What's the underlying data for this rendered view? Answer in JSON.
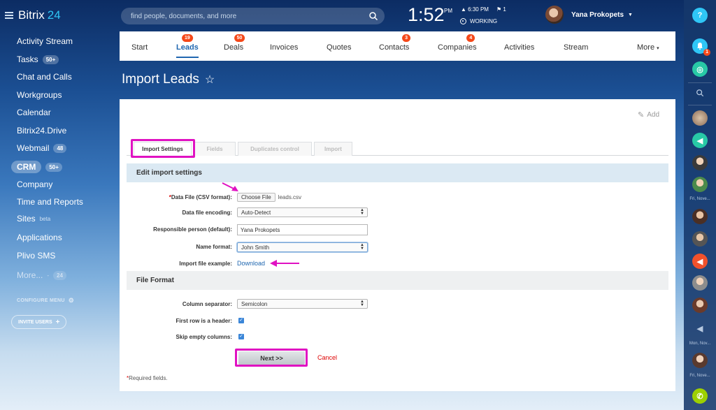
{
  "app": {
    "brand": "Bitrix",
    "brand_num": "24"
  },
  "sidebar": {
    "items": [
      {
        "label": "Activity Stream"
      },
      {
        "label": "Tasks",
        "badge": "50+"
      },
      {
        "label": "Chat and Calls"
      },
      {
        "label": "Workgroups"
      },
      {
        "label": "Calendar"
      },
      {
        "label": "Bitrix24.Drive"
      },
      {
        "label": "Webmail",
        "badge": "48"
      },
      {
        "label": "CRM",
        "badge": "50+"
      },
      {
        "label": "Company"
      },
      {
        "label": "Time and Reports"
      },
      {
        "label": "Sites",
        "sup": "beta"
      },
      {
        "label": "Applications"
      },
      {
        "label": "Plivo SMS"
      },
      {
        "label": "More...",
        "badge": "24"
      }
    ],
    "configure_menu": "CONFIGURE MENU",
    "invite_users": "INVITE USERS"
  },
  "header": {
    "search_placeholder": "find people, documents, and more",
    "clock": "1:52",
    "clock_ampm": "PM",
    "alarm": "6:30 PM",
    "flags": "1",
    "status": "WORKING",
    "user_name": "Yana Prokopets"
  },
  "right_sidebar": {
    "help": "?",
    "notifications_count": "1",
    "label_fri1": "Fri, Nove...",
    "label_mon": "Mon, Nov...",
    "label_fri2": "Fri, Nove..."
  },
  "crm_tabs": [
    {
      "label": "Start"
    },
    {
      "label": "Leads",
      "badge": "19"
    },
    {
      "label": "Deals",
      "badge": "50"
    },
    {
      "label": "Invoices"
    },
    {
      "label": "Quotes"
    },
    {
      "label": "Contacts",
      "badge": "3"
    },
    {
      "label": "Companies",
      "badge": "4"
    },
    {
      "label": "Activities"
    },
    {
      "label": "Stream"
    },
    {
      "label": "More"
    }
  ],
  "page": {
    "title": "Import Leads",
    "title_star": "☆",
    "add_label": "Add"
  },
  "steps": [
    "Import Settings",
    "Fields",
    "Duplicates control",
    "Import"
  ],
  "form": {
    "edit_settings_header": "Edit import settings",
    "data_file_label": "Data File (CSV format):",
    "choose_file": "Choose File",
    "file_name": "leads.csv",
    "encoding_label": "Data file encoding:",
    "encoding_value": "Auto-Detect",
    "responsible_label": "Responsible person (default):",
    "responsible_value": "Yana Prokopets",
    "name_format_label": "Name format:",
    "name_format_value": "John Smith",
    "example_label": "Import file example:",
    "download": "Download",
    "file_format_header": "File Format",
    "separator_label": "Column separator:",
    "separator_value": "Semicolon",
    "first_row_label": "First row is a header:",
    "first_row_checked": true,
    "skip_empty_label": "Skip empty columns:",
    "skip_empty_checked": true,
    "next": "Next >>",
    "cancel": "Cancel",
    "required_note": "Required fields."
  },
  "colors": {
    "accent": "#2067b0",
    "highlight": "#e012c2",
    "badge": "#f54819"
  }
}
